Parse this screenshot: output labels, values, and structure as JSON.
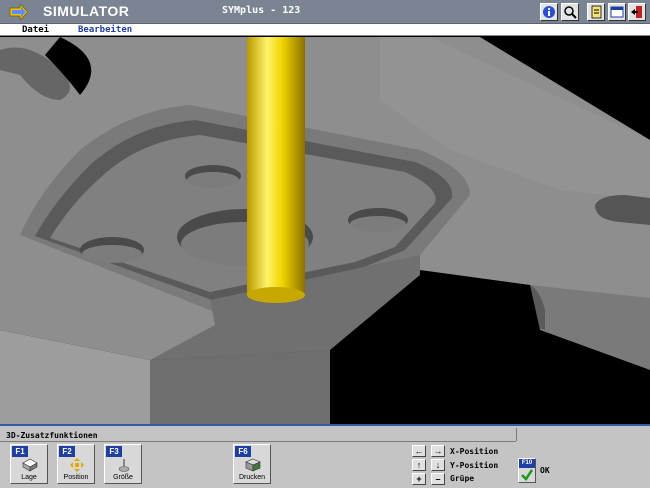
{
  "title_bar": {
    "app_name": "SIMULATOR",
    "window_title": "SYMplus - 123"
  },
  "menu": {
    "items": [
      "Datei",
      "Bearbeiten"
    ]
  },
  "panel": {
    "title": "3D-Zusatzfunktionen",
    "fkeys": [
      {
        "tag": "F1",
        "label": "Lage",
        "icon": "rotate-cube-icon"
      },
      {
        "tag": "F2",
        "label": "Position",
        "icon": "move-arrows-icon"
      },
      {
        "tag": "F3",
        "label": "Größe",
        "icon": "scale-icon"
      },
      {
        "tag": "F6",
        "label": "Drucken",
        "icon": "print-cube-icon"
      }
    ],
    "arrows": {
      "left": "←",
      "right": "→",
      "up": "↑",
      "down": "↓",
      "plus": "+",
      "minus": "–"
    },
    "x_position_label": "X-Position",
    "y_position_label": "Y-Position",
    "size_label": "Grüpe",
    "ok": {
      "tag": "F10",
      "label": "OK"
    }
  },
  "colors": {
    "title_bar": "#7a8492",
    "panel": "#c4c4c4",
    "fkey_tag": "#1e3fa0",
    "tool": "#f2d600",
    "workpiece": "#8c8c8c"
  }
}
